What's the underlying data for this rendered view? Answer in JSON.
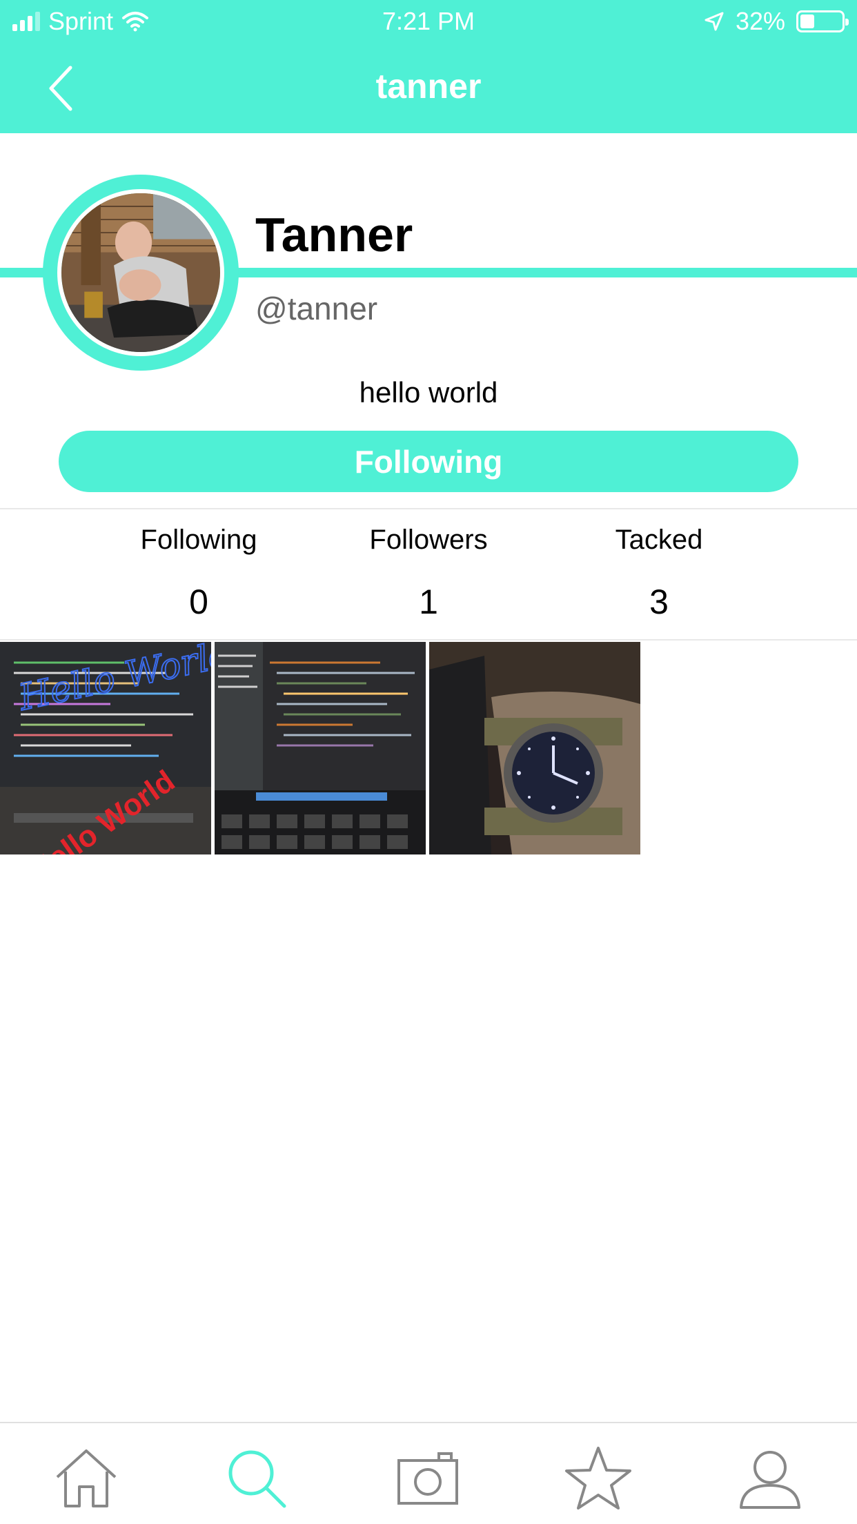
{
  "status_bar": {
    "carrier": "Sprint",
    "time": "7:21 PM",
    "battery": "32%"
  },
  "nav": {
    "title": "tanner"
  },
  "profile": {
    "display_name": "Tanner",
    "handle": "@tanner",
    "bio": "hello world",
    "follow_button_label": "Following"
  },
  "stats": [
    {
      "label": "Following",
      "value": "0"
    },
    {
      "label": "Followers",
      "value": "1"
    },
    {
      "label": "Tacked",
      "value": "3"
    }
  ],
  "posts": [
    {
      "description": "code on laptop screen with Hello World doodles",
      "overlay_text_1": "Hello World!",
      "overlay_text_2": "Hello World"
    },
    {
      "description": "code editor on laptop screen"
    },
    {
      "description": "wristwatch on wrist"
    }
  ],
  "tabs": [
    {
      "name": "home",
      "active": false
    },
    {
      "name": "search",
      "active": true
    },
    {
      "name": "camera",
      "active": false
    },
    {
      "name": "star",
      "active": false
    },
    {
      "name": "profile",
      "active": false
    }
  ],
  "colors": {
    "accent": "#4ff0d5",
    "inactive_icon": "#888888"
  }
}
